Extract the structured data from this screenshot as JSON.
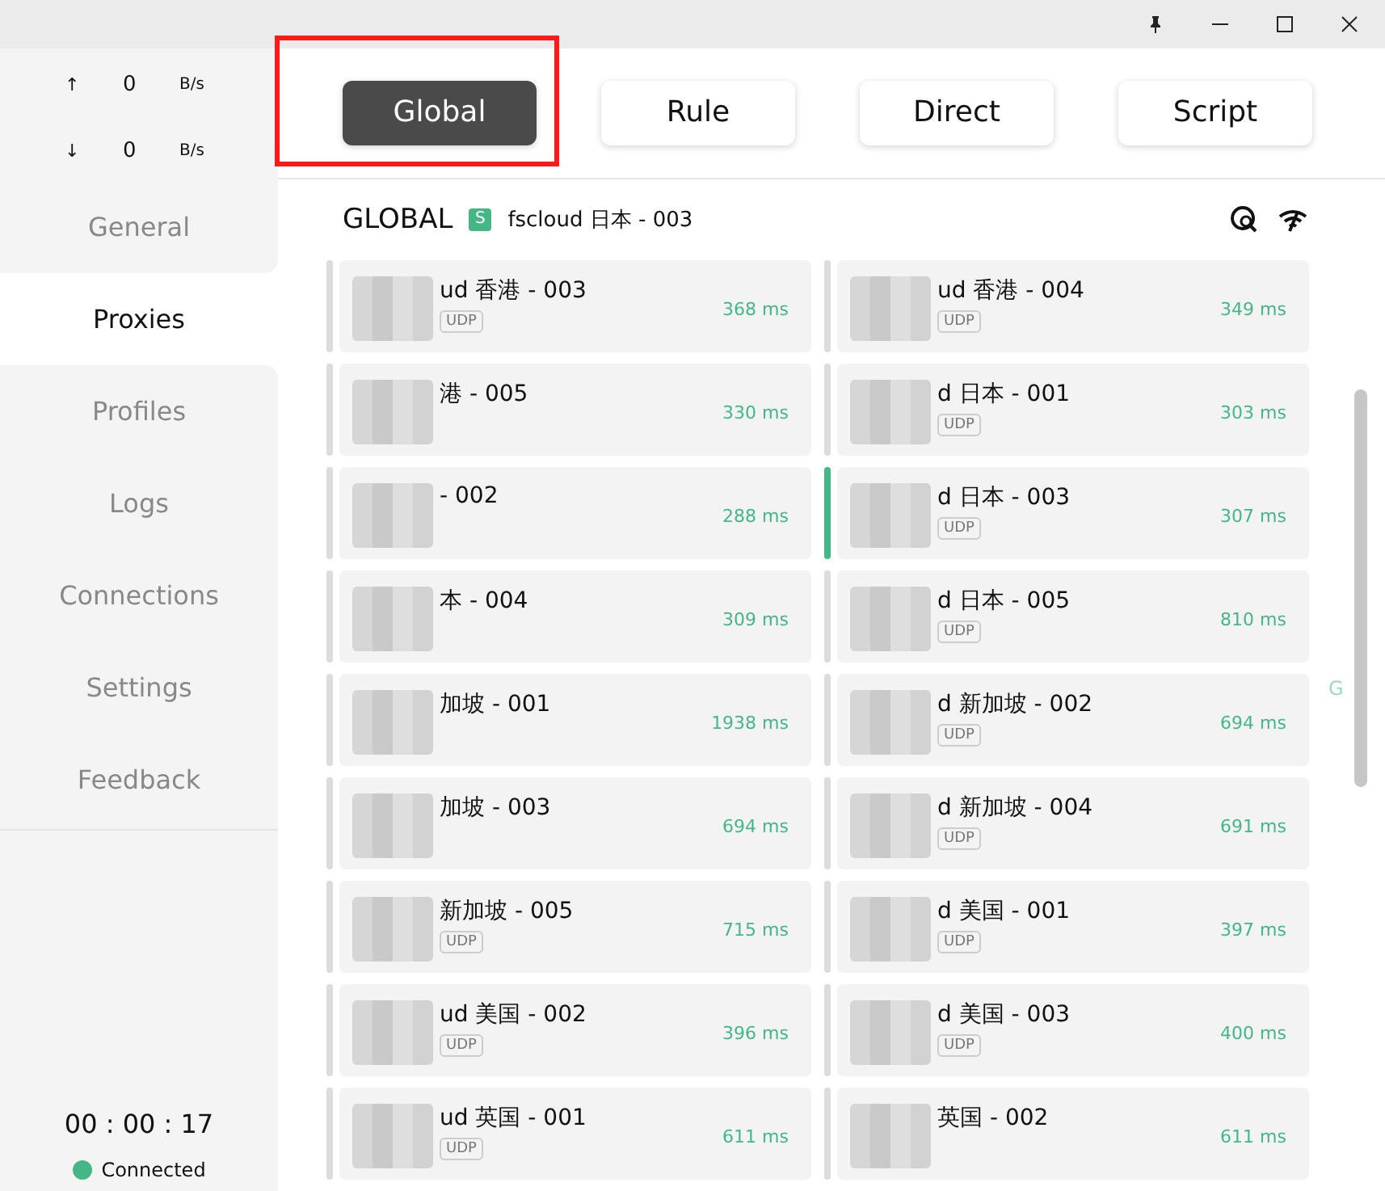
{
  "traffic": [
    {
      "arrow": "↑",
      "value": "0",
      "unit": "B/s"
    },
    {
      "arrow": "↓",
      "value": "0",
      "unit": "B/s"
    }
  ],
  "sidebar": {
    "items": [
      {
        "label": "General",
        "selected": false
      },
      {
        "label": "Proxies",
        "selected": true
      },
      {
        "label": "Profiles",
        "selected": false
      },
      {
        "label": "Logs",
        "selected": false
      },
      {
        "label": "Connections",
        "selected": false
      },
      {
        "label": "Settings",
        "selected": false
      },
      {
        "label": "Feedback",
        "selected": false
      }
    ],
    "timer": "00 : 00 : 17",
    "status": "Connected"
  },
  "modes": [
    {
      "label": "Global",
      "selected": true,
      "outlined": true
    },
    {
      "label": "Rule",
      "selected": false,
      "outlined": false
    },
    {
      "label": "Direct",
      "selected": false,
      "outlined": false
    },
    {
      "label": "Script",
      "selected": false,
      "outlined": false
    }
  ],
  "group": {
    "title": "GLOBAL",
    "badge": "S",
    "current": "fscloud 日本 - 003"
  },
  "proxies": [
    {
      "name": "ud 香港 - 003",
      "tag": "UDP",
      "delay": "368 ms",
      "selected": false,
      "redacted": true
    },
    {
      "name": "ud 香港 - 004",
      "tag": "UDP",
      "delay": "349 ms",
      "selected": false,
      "redacted": true
    },
    {
      "name": "港 - 005",
      "delay": "330 ms",
      "selected": false,
      "redacted": true
    },
    {
      "name": "d 日本 - 001",
      "tag": "UDP",
      "delay": "303 ms",
      "selected": false,
      "redacted": true
    },
    {
      "name": "- 002",
      "delay": "288 ms",
      "selected": false,
      "redacted": true
    },
    {
      "name": "d 日本 - 003",
      "tag": "UDP",
      "delay": "307 ms",
      "selected": true,
      "redacted": true
    },
    {
      "name": "本 - 004",
      "delay": "309 ms",
      "selected": false,
      "redacted": true
    },
    {
      "name": "d 日本 - 005",
      "tag": "UDP",
      "delay": "810 ms",
      "selected": false,
      "redacted": true
    },
    {
      "name": "加坡 - 001",
      "delay": "1938 ms",
      "selected": false,
      "redacted": true
    },
    {
      "name": "d 新加坡 - 002",
      "tag": "UDP",
      "delay": "694 ms",
      "selected": false,
      "redacted": true
    },
    {
      "name": "加坡 - 003",
      "delay": "694 ms",
      "selected": false,
      "redacted": true
    },
    {
      "name": "d 新加坡 - 004",
      "tag": "UDP",
      "delay": "691 ms",
      "selected": false,
      "redacted": true
    },
    {
      "name": "新加坡 - 005",
      "tag": "UDP",
      "delay": "715 ms",
      "selected": false,
      "redacted": true
    },
    {
      "name": "d 美国 - 001",
      "tag": "UDP",
      "delay": "397 ms",
      "selected": false,
      "redacted": true
    },
    {
      "name": "ud 美国 - 002",
      "tag": "UDP",
      "delay": "396 ms",
      "selected": false,
      "redacted": true
    },
    {
      "name": "d 美国 - 003",
      "tag": "UDP",
      "delay": "400 ms",
      "selected": false,
      "redacted": true
    },
    {
      "name": "ud 英国 - 001",
      "tag": "UDP",
      "delay": "611 ms",
      "selected": false,
      "redacted": true
    },
    {
      "name": "英国 - 002",
      "delay": "611 ms",
      "selected": false,
      "redacted": true
    }
  ],
  "index_letter": "G"
}
